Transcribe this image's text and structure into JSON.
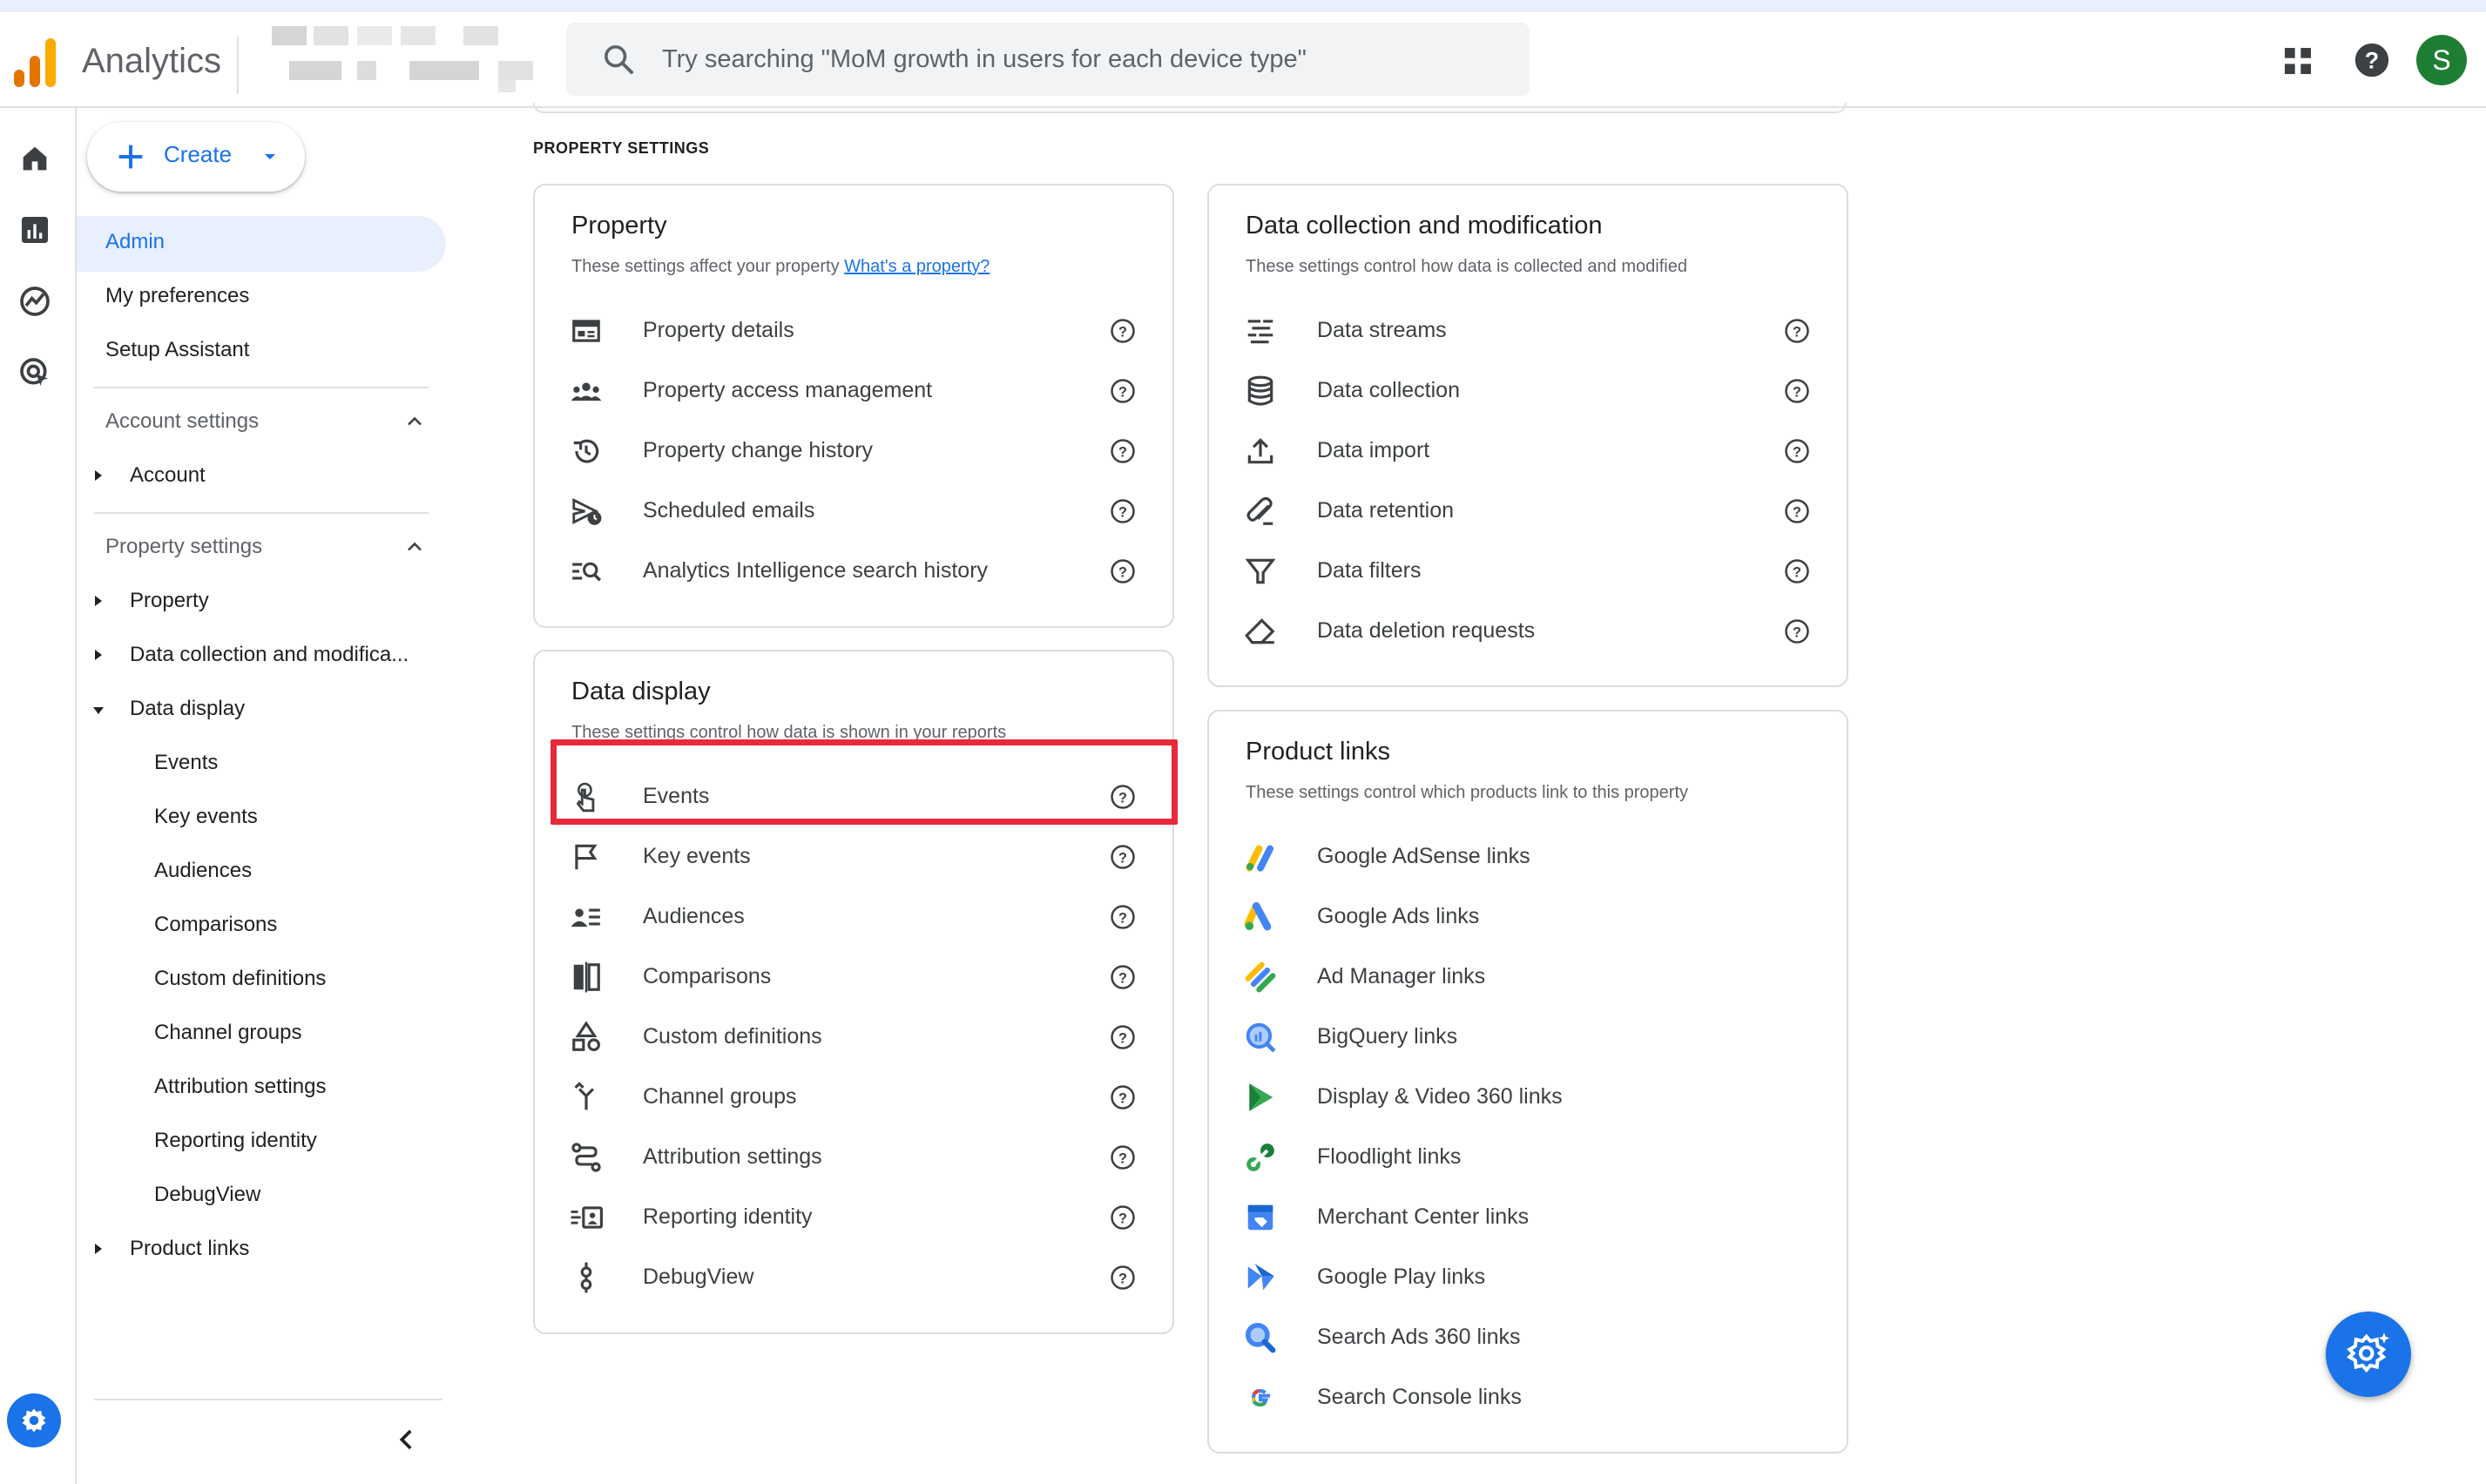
{
  "app": {
    "title": "Analytics"
  },
  "search": {
    "placeholder": "Try searching \"MoM growth in users for each device type\""
  },
  "header": {
    "avatar_letter": "S"
  },
  "sidebar": {
    "create_label": "Create",
    "items": [
      {
        "label": "Admin"
      },
      {
        "label": "My preferences"
      },
      {
        "label": "Setup Assistant"
      }
    ],
    "account_settings": {
      "label": "Account settings",
      "children": [
        "Account"
      ]
    },
    "property_settings": {
      "label": "Property settings",
      "property": "Property",
      "data_collection": "Data collection and modifica...",
      "data_display": "Data display",
      "data_display_children": [
        "Events",
        "Key events",
        "Audiences",
        "Comparisons",
        "Custom definitions",
        "Channel groups",
        "Attribution settings",
        "Reporting identity",
        "DebugView"
      ],
      "product_links": "Product links"
    }
  },
  "main": {
    "section_title": "PROPERTY SETTINGS",
    "property_card": {
      "title": "Property",
      "desc": "These settings affect your property",
      "link": "What's a property?",
      "rows": [
        "Property details",
        "Property access management",
        "Property change history",
        "Scheduled emails",
        "Analytics Intelligence search history"
      ]
    },
    "data_collection_card": {
      "title": "Data collection and modification",
      "desc": "These settings control how data is collected and modified",
      "rows": [
        "Data streams",
        "Data collection",
        "Data import",
        "Data retention",
        "Data filters",
        "Data deletion requests"
      ]
    },
    "data_display_card": {
      "title": "Data display",
      "desc": "These settings control how data is shown in your reports",
      "rows": [
        "Events",
        "Key events",
        "Audiences",
        "Comparisons",
        "Custom definitions",
        "Channel groups",
        "Attribution settings",
        "Reporting identity",
        "DebugView"
      ]
    },
    "product_links_card": {
      "title": "Product links",
      "desc": "These settings control which products link to this property",
      "rows": [
        "Google AdSense links",
        "Google Ads links",
        "Ad Manager links",
        "BigQuery links",
        "Display & Video 360 links",
        "Floodlight links",
        "Merchant Center links",
        "Google Play links",
        "Search Ads 360 links",
        "Search Console links"
      ]
    }
  },
  "colors": {
    "accent": "#1a73e8",
    "highlight": "#e8293b",
    "avatar": "#1e7e34"
  }
}
